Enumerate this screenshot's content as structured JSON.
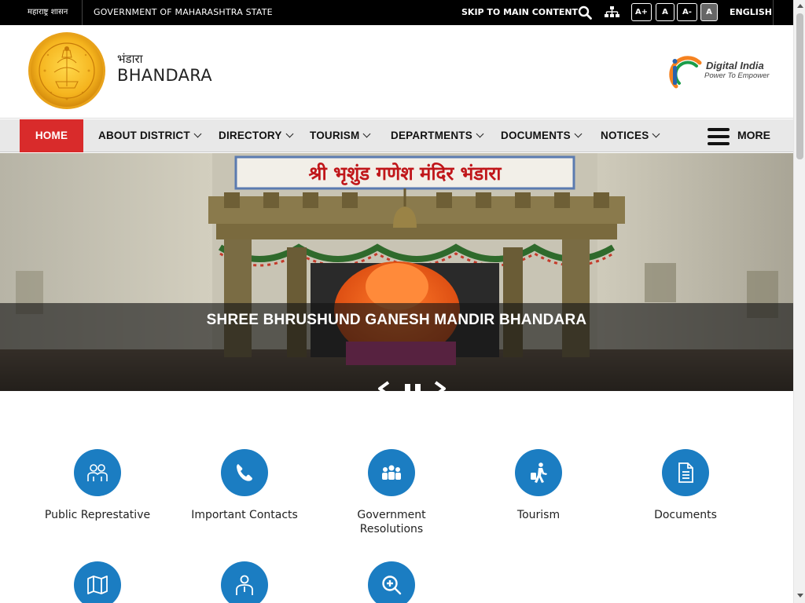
{
  "topbar": {
    "gov_marathi": "महाराष्ट्र शासन",
    "gov_english": "GOVERNMENT OF MAHARASHTRA STATE",
    "skip_link": "SKIP TO MAIN CONTENT",
    "search_icon": "search-icon",
    "sitemap_icon": "sitemap-icon",
    "font_increase": "A+",
    "font_normal": "A",
    "font_decrease": "A-",
    "contrast": "A",
    "language": "ENGLISH"
  },
  "header": {
    "site_name_marathi": "भंडारा",
    "site_name_english": "BHANDARA",
    "digital_india_title": "Digital India",
    "digital_india_tagline": "Power To Empower"
  },
  "nav": {
    "home": "HOME",
    "about": "ABOUT DISTRICT",
    "directory": "DIRECTORY",
    "tourism": "TOURISM",
    "departments": "DEPARTMENTS",
    "documents": "DOCUMENTS",
    "notices": "NOTICES",
    "more": "MORE"
  },
  "slider": {
    "caption": "SHREE BHRUSHUND GANESH MANDIR BHANDARA",
    "temple_sign": "श्री भृशुंड गणेश मंदिर भंडारा"
  },
  "quick_links": [
    {
      "label": "Public Represtative",
      "icon": "people-icon"
    },
    {
      "label": "Important Contacts",
      "icon": "phone-icon"
    },
    {
      "label": "Government Resolutions",
      "icon": "group-icon"
    },
    {
      "label": "Tourism",
      "icon": "traveler-icon"
    },
    {
      "label": "Documents",
      "icon": "document-icon"
    },
    {
      "label": "",
      "icon": "map-icon"
    },
    {
      "label": "",
      "icon": "person-icon"
    },
    {
      "label": "",
      "icon": "zoom-in-icon"
    }
  ],
  "colors": {
    "accent_red": "#d92b2b",
    "icon_blue": "#1b7dc2",
    "topbar": "#000000",
    "nav_bg": "#e8e8e8"
  }
}
